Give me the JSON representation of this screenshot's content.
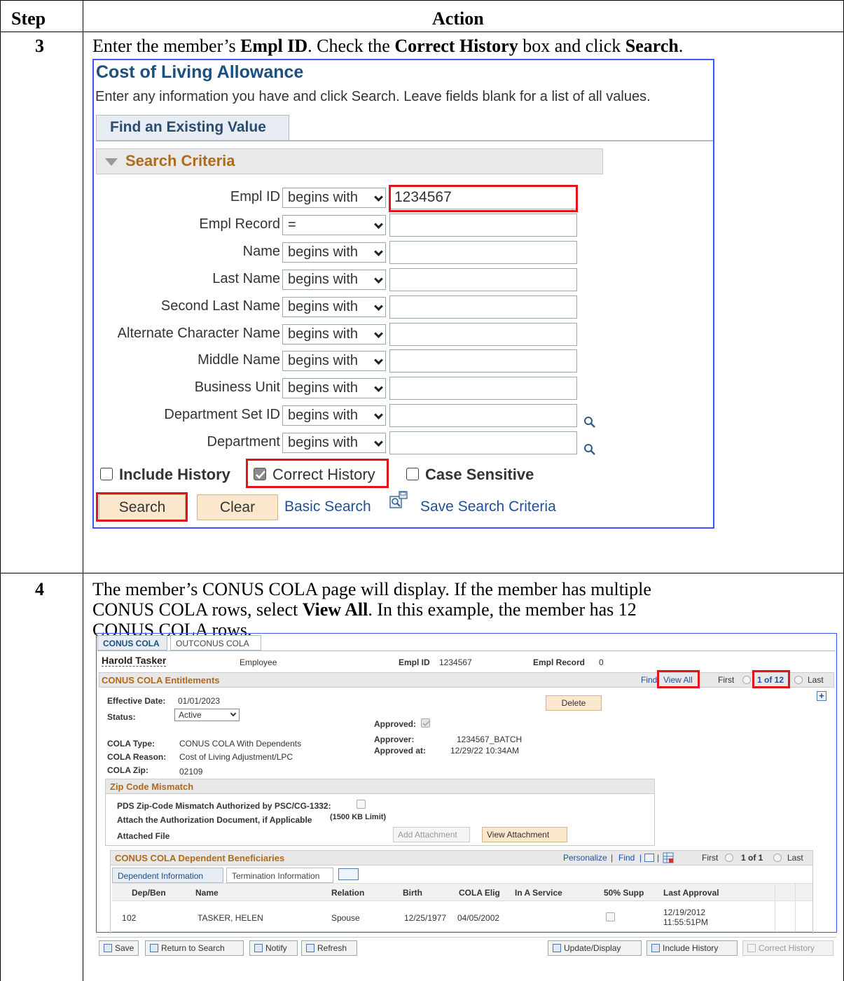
{
  "table": {
    "header_step": "Step",
    "header_action": "Action",
    "step3_number": "3",
    "step3_text_a": "Enter the member’s ",
    "step3_bold_a": "Empl ID",
    "step3_text_b": ".  Check the ",
    "step3_bold_b": "Correct History",
    "step3_text_c": " box and click ",
    "step3_bold_c": "Search",
    "step3_text_d": ".",
    "step4_number": "4",
    "step4_line1": "The member’s CONUS COLA page will display.  If the member has multiple",
    "step4_line2a": "CONUS COLA rows, select ",
    "step4_line2b": "View All",
    "step4_line2c": ".  In this example, the member has 12",
    "step4_line3": "CONUS COLA rows."
  },
  "search_page": {
    "title": "Cost of Living Allowance",
    "instructions": "Enter any information you have and click Search. Leave fields blank for a list of all values.",
    "tab": "Find an Existing Value",
    "criteria_header": "Search Criteria",
    "fields": [
      {
        "label": "Empl ID",
        "operator": "begins with",
        "value": "1234567"
      },
      {
        "label": "Empl Record",
        "operator": "=",
        "value": ""
      },
      {
        "label": "Name",
        "operator": "begins with",
        "value": ""
      },
      {
        "label": "Last Name",
        "operator": "begins with",
        "value": ""
      },
      {
        "label": "Second Last Name",
        "operator": "begins with",
        "value": ""
      },
      {
        "label": "Alternate Character Name",
        "operator": "begins with",
        "value": ""
      },
      {
        "label": "Middle Name",
        "operator": "begins with",
        "value": ""
      },
      {
        "label": "Business Unit",
        "operator": "begins with",
        "value": ""
      },
      {
        "label": "Department Set ID",
        "operator": "begins with",
        "value": ""
      },
      {
        "label": "Department",
        "operator": "begins with",
        "value": ""
      }
    ],
    "include_history": "Include History",
    "correct_history": "Correct History",
    "correct_history_checked": true,
    "case_sensitive": "Case Sensitive",
    "search_button": "Search",
    "clear_button": "Clear",
    "basic_search": "Basic Search",
    "save_search": "Save Search Criteria"
  },
  "cola_page": {
    "tabs": [
      "CONUS COLA",
      "OUTCONUS COLA"
    ],
    "name": "Harold Tasker",
    "role": "Employee",
    "empl_id_label": "Empl ID",
    "empl_id": "1234567",
    "empl_record_label": "Empl Record",
    "empl_record": "0",
    "section_title": "CONUS COLA Entitlements",
    "find": "Find",
    "view_all": "View All",
    "first": "First",
    "count": "1 of 12",
    "last": "Last",
    "effective_date_label": "Effective Date:",
    "effective_date": "01/01/2023",
    "delete_button": "Delete",
    "status_label": "Status:",
    "status_value": "Active",
    "approved_label": "Approved:",
    "approver_label": "Approver:",
    "approver_value": "1234567_BATCH",
    "approved_at_label": "Approved at:",
    "approved_at_value": "12/29/22 10:34AM",
    "cola_type_label": "COLA Type:",
    "cola_type_value": "CONUS COLA With Dependents",
    "cola_reason_label": "COLA Reason:",
    "cola_reason_value": "Cost of Living Adjustment/LPC",
    "cola_zip_label": "COLA Zip:",
    "cola_zip_value": "02109",
    "zip_mismatch_title": "Zip Code Mismatch",
    "pds_label": "PDS Zip-Code Mismatch Authorized by PSC/CG-1332:",
    "attach_label": "Attach the Authorization Document, if Applicable",
    "attach_limit": "(1500 KB Limit)",
    "attached_file_label": "Attached File",
    "add_attachment": "Add Attachment",
    "view_attachment": "View Attachment",
    "dep_title": "CONUS COLA Dependent Beneficiaries",
    "personalize": "Personalize",
    "dep_find": "Find",
    "dep_first": "First",
    "dep_count": "1 of 1",
    "dep_last": "Last",
    "dep_tabs": [
      "Dependent Information",
      "Termination Information"
    ],
    "columns": [
      "Dep/Ben",
      "Name",
      "Relation",
      "Birth",
      "COLA Elig",
      "In A Service",
      "50% Supp",
      "Last Approval"
    ],
    "row": {
      "num": "1",
      "dep_ben": "02",
      "name": "TASKER, HELEN",
      "relation": "Spouse",
      "birth": "12/25/1977",
      "cola_elig": "04/05/2002",
      "last_approval_1": "12/19/2012",
      "last_approval_2": "11:55:51PM"
    },
    "toolbar": [
      "Save",
      "Return to Search",
      "Notify",
      "Refresh"
    ],
    "toolbar_right": [
      "Update/Display",
      "Include History",
      "Correct History"
    ]
  },
  "colors": {
    "highlight": "#e0141b",
    "frame": "#3b55ff",
    "ps_title": "#1c4e80",
    "criteria": "#b06a1a"
  }
}
